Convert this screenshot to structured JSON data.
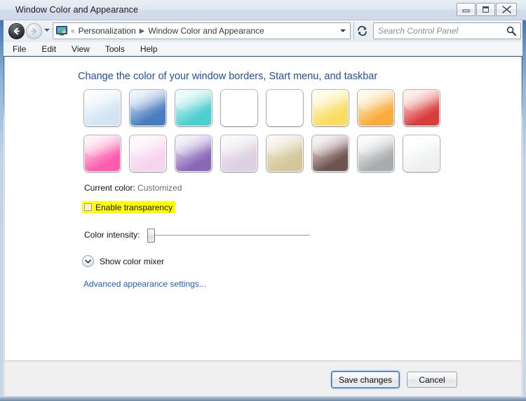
{
  "window": {
    "title": "Window Color and Appearance",
    "controls": {
      "minimize": "minimize-button",
      "maximize": "maximize-button",
      "close": "close-button"
    }
  },
  "nav": {
    "back_label": "Back",
    "forward_label": "Forward",
    "refresh_label": "Refresh",
    "breadcrumb_overflow": "«",
    "breadcrumb": [
      {
        "label": "Personalization"
      },
      {
        "label": "Window Color and Appearance"
      }
    ],
    "breadcrumb_separator": "▶"
  },
  "search": {
    "value": "",
    "placeholder": "Search Control Panel"
  },
  "menubar": {
    "items": [
      {
        "label": "File"
      },
      {
        "label": "Edit"
      },
      {
        "label": "View"
      },
      {
        "label": "Tools"
      },
      {
        "label": "Help"
      }
    ]
  },
  "main": {
    "page_title": "Change the color of your window borders, Start menu, and taskbar",
    "swatches": [
      {
        "name": "sky",
        "selected": false,
        "top": "#f2f8fd",
        "bottom": "#d3e4f3"
      },
      {
        "name": "blue",
        "selected": false,
        "top": "#c4d7ee",
        "bottom": "#4a7cc0"
      },
      {
        "name": "teal",
        "selected": false,
        "top": "#cdf2f2",
        "bottom": "#4ccfd0"
      },
      {
        "name": "green",
        "selected": false,
        "top": "#cdeec4",
        "bottom": "#44b council"
      },
      {
        "name": "lime",
        "selected": false,
        "top": "#dcf1b8",
        "bottom": "#97d košic"
      },
      {
        "name": "yellow",
        "selected": false,
        "top": "#fdf6c8",
        "bottom": "#f7dd62"
      },
      {
        "name": "orange",
        "selected": false,
        "top": "#fdeac2",
        "bottom": "#f9ab3c"
      },
      {
        "name": "red",
        "selected": false,
        "top": "#f6cdc9",
        "bottom": "#d93c3c"
      },
      {
        "name": "pink",
        "selected": false,
        "top": "#fdd2e6",
        "bottom": "#fb5cae"
      },
      {
        "name": "rose",
        "selected": false,
        "top": "#fcedf7",
        "bottom": "#f6d4ee"
      },
      {
        "name": "violet",
        "selected": false,
        "top": "#ded3ec",
        "bottom": "#8a68b8"
      },
      {
        "name": "lavender",
        "selected": false,
        "top": "#f1eaf2",
        "bottom": "#ddd0e0"
      },
      {
        "name": "khaki",
        "selected": false,
        "top": "#ebe5cf",
        "bottom": "#d4c79b"
      },
      {
        "name": "taupe",
        "selected": false,
        "top": "#e3cfcf",
        "bottom": "#6e5450"
      },
      {
        "name": "graphite",
        "selected": false,
        "top": "#f0f0f0",
        "bottom": "#a9acae"
      },
      {
        "name": "frost",
        "selected": false,
        "top": "#ffffff",
        "bottom": "#eef0f1"
      }
    ],
    "current_color": {
      "label": "Current color:",
      "value": "Customized"
    },
    "transparency": {
      "label": "Enable transparency",
      "checked": false,
      "highlight": "#ffff00"
    },
    "intensity": {
      "label": "Color intensity:",
      "value": 0,
      "min": 0,
      "max": 100
    },
    "color_mixer": {
      "label": "Show color mixer",
      "expanded": false,
      "icon": "chevron-down-icon"
    },
    "advanced_link": "Advanced appearance settings..."
  },
  "footer": {
    "save_label": "Save changes",
    "cancel_label": "Cancel"
  },
  "colors": {
    "link": "#1f5fc4",
    "heading": "#1f4fa3",
    "highlight": "#ffff00",
    "frame": "#2d5d9c"
  }
}
